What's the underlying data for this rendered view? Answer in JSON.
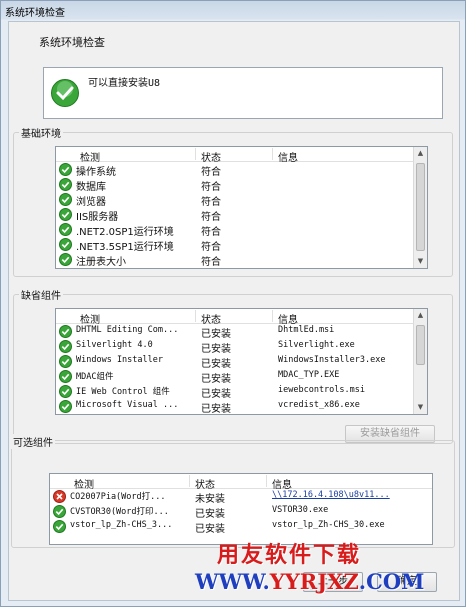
{
  "window": {
    "title": "系统环境检查"
  },
  "heading": "系统环境检查",
  "status": {
    "icon": "check-circle-icon",
    "text": "可以直接安装U8"
  },
  "columns": {
    "check": "检测",
    "state": "状态",
    "info": "信息"
  },
  "basic": {
    "title": "基础环境",
    "rows": [
      {
        "name": "操作系统",
        "state": "符合",
        "info": ""
      },
      {
        "name": "数据库",
        "state": "符合",
        "info": ""
      },
      {
        "name": "浏览器",
        "state": "符合",
        "info": ""
      },
      {
        "name": "IIS服务器",
        "state": "符合",
        "info": ""
      },
      {
        "name": ".NET2.0SP1运行环境",
        "state": "符合",
        "info": ""
      },
      {
        "name": ".NET3.5SP1运行环境",
        "state": "符合",
        "info": ""
      },
      {
        "name": "注册表大小",
        "state": "符合",
        "info": ""
      }
    ]
  },
  "default": {
    "title": "缺省组件",
    "rows": [
      {
        "name": "DHTML Editing Com...",
        "state": "已安装",
        "info": "DhtmlEd.msi"
      },
      {
        "name": "Silverlight 4.0",
        "state": "已安装",
        "info": "Silverlight.exe"
      },
      {
        "name": "Windows Installer",
        "state": "已安装",
        "info": "WindowsInstaller3.exe"
      },
      {
        "name": "MDAC组件",
        "state": "已安装",
        "info": "MDAC_TYP.EXE"
      },
      {
        "name": "IE Web Control 组件",
        "state": "已安装",
        "info": "iewebcontrols.msi"
      },
      {
        "name": "Microsoft Visual ...",
        "state": "已安装",
        "info": "vcredist_x86.exe"
      }
    ],
    "install_button": "安装缺省组件"
  },
  "optional": {
    "title": "可选组件",
    "rows": [
      {
        "name": "CO2007Pia(Word打...",
        "state": "未安装",
        "info": "\\\\172.16.4.108\\u8v11...",
        "status": "error"
      },
      {
        "name": "CVSTOR30(Word打印...",
        "state": "已安装",
        "info": "VSTOR30.exe",
        "status": "ok"
      },
      {
        "name": "vstor_lp_Zh-CHS_3...",
        "state": "已安装",
        "info": "vstor_lp_Zh-CHS_30.exe",
        "status": "ok"
      }
    ]
  },
  "buttons": {
    "back": "上一步",
    "confirm": "确定"
  },
  "watermark": {
    "line1": "用友软件下载",
    "line2a": "WWW.",
    "line2b": "YYRJXZ",
    "line2c": ".COM"
  },
  "colors": {
    "ok": "#3aa63a",
    "error": "#d83a2a",
    "link": "#1b3fa0"
  }
}
